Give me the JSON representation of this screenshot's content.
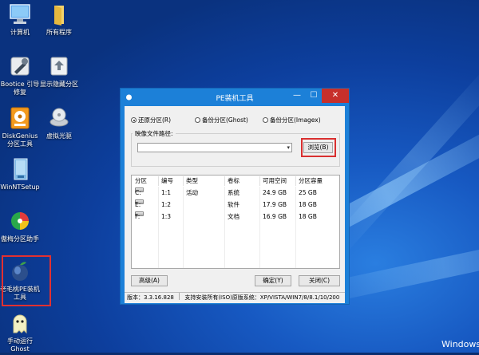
{
  "desktop": {
    "icons": [
      {
        "id": "computer",
        "label": "计算机"
      },
      {
        "id": "programs",
        "label": "所有程序"
      },
      {
        "id": "bootice",
        "label": "Bootice 引导\n修复"
      },
      {
        "id": "partition",
        "label": "显示隐藏分区"
      },
      {
        "id": "diskgenius",
        "label": "DiskGenius\n分区工具"
      },
      {
        "id": "vdrive",
        "label": "虚拟光驱"
      },
      {
        "id": "winnt",
        "label": "WinNTSetup"
      },
      {
        "id": "aomei",
        "label": "傲梅分区助手"
      },
      {
        "id": "laomaotao",
        "label": "老毛桃PE装机\n工具"
      },
      {
        "id": "ghost",
        "label": "手动运行\nGhost"
      }
    ],
    "watermark": "Windows",
    "highlight_color": "#e23030"
  },
  "window": {
    "title": "PE装机工具",
    "minimize": "—",
    "maximize": "☐",
    "close": "✕",
    "close_color": "#c7302b",
    "radios": [
      {
        "label": "还原分区(R)",
        "checked": true
      },
      {
        "label": "备份分区(Ghost)",
        "checked": false
      },
      {
        "label": "备份分区(Imagex)",
        "checked": false
      }
    ],
    "image_path_label": "映像文件路径:",
    "image_path_value": "",
    "browse_button": "浏览(B)",
    "table": {
      "headers": [
        "分区",
        "编号",
        "类型",
        "卷标",
        "可用空间",
        "分区容量"
      ],
      "rows": [
        [
          "C:",
          "1:1",
          "活动",
          "系统",
          "24.9 GB",
          "25 GB"
        ],
        [
          "E:",
          "1:2",
          "",
          "软件",
          "17.9 GB",
          "18 GB"
        ],
        [
          "F:",
          "1:3",
          "",
          "文档",
          "16.9 GB",
          "18 GB"
        ]
      ]
    },
    "advanced_button": "高级(A)",
    "ok_button": "确定(Y)",
    "close_button": "关闭(C)",
    "status": {
      "version": "版本：3.3.16.828",
      "support": "支持安装所有(ISO)原版系统：XP/VISTA/WIN7/8/8.1/10/200"
    }
  }
}
